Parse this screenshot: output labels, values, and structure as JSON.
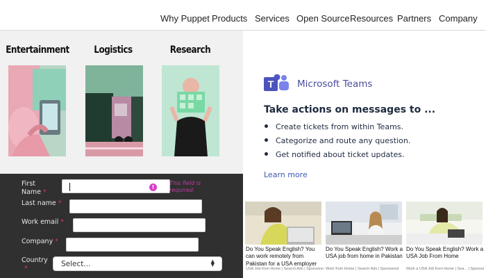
{
  "nav": {
    "items": [
      "Why Puppet",
      "Products",
      "Services",
      "Open Source",
      "Resources",
      "Partners",
      "Company"
    ]
  },
  "industries": [
    {
      "title": "Entertainment"
    },
    {
      "title": "Logistics"
    },
    {
      "title": "Research"
    }
  ],
  "form": {
    "first_name_label_line1": "First",
    "first_name_label_line2": "Name",
    "required_marker": "*",
    "error_message": "This field is required.",
    "last_name_label": "Last name",
    "work_email_label": "Work email",
    "company_label": "Company",
    "country_label": "Country",
    "country_selected": "Select...",
    "error_icon": "!"
  },
  "teams_card": {
    "brand": "Microsoft Teams",
    "logo_letter": "T",
    "headline": "Take actions on messages to ...",
    "bullets": [
      "Create tickets from within Teams.",
      "Categorize and route any question.",
      "Get notified about ticket updates."
    ],
    "learn_more": "Learn more",
    "brand_color": "#4b4d9c"
  },
  "ads": [
    {
      "title": "Do You Speak English? You can work remotely from Pakistan for a USA employer",
      "source": "USA Job from Home | Search Ads | Sponsored"
    },
    {
      "title": "Do You Speak English? Work a USA job from home in Pakistan",
      "source": "Work from Home | Search Ads | Sponsored"
    },
    {
      "title": "Do You Speak English? Work a USA Job From Home",
      "source": "Work a USA Job from Home | Sea... | Sponsored"
    }
  ],
  "colors": {
    "form_bg": "#2f302f",
    "error": "#c23aa6",
    "link": "#3d57b5"
  }
}
